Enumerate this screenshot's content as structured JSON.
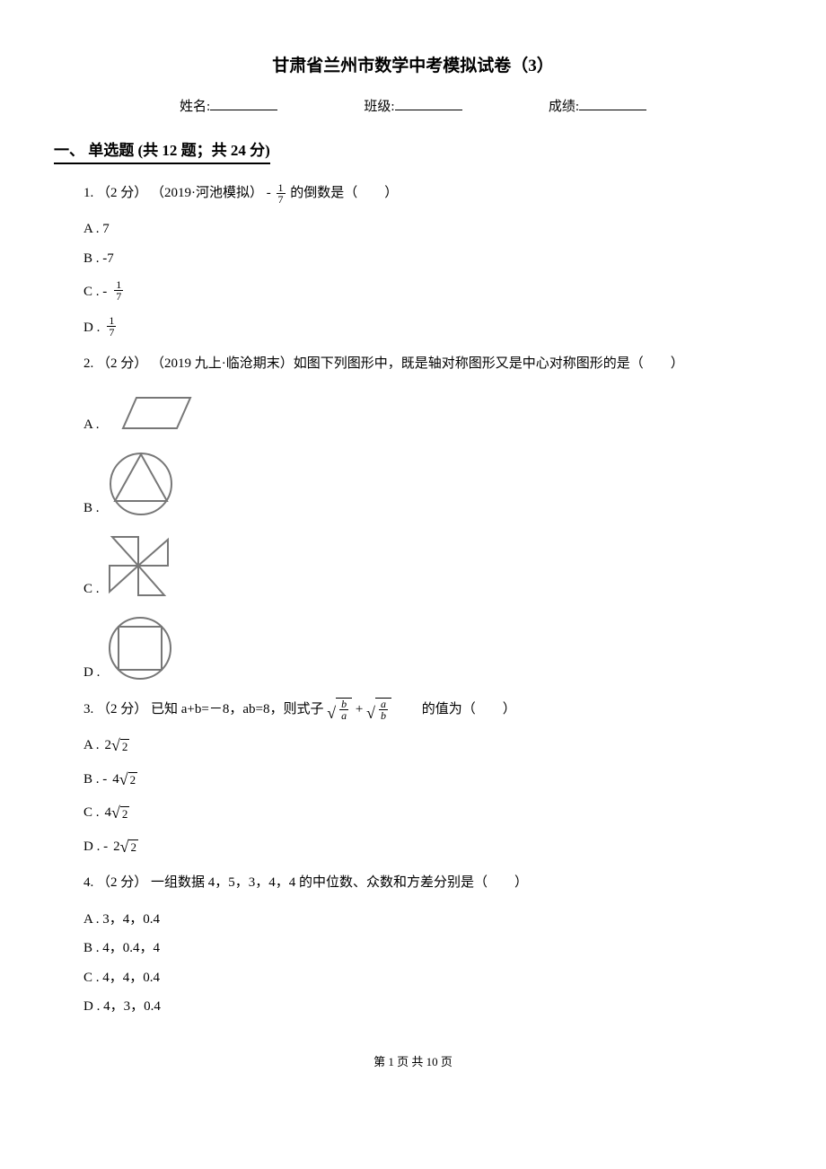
{
  "title": "甘肃省兰州市数学中考模拟试卷（3）",
  "meta": {
    "name_label": "姓名:",
    "class_label": "班级:",
    "score_label": "成绩:"
  },
  "section1": {
    "header": "一、 单选题 (共 12 题；共 24 分)"
  },
  "q1": {
    "stem_a": "1.  （2 分） （2019·河池模拟） - ",
    "frac_n": "1",
    "frac_d": "7",
    "stem_b": " 的倒数是（　　）",
    "A": "A .  7",
    "B": "B .  -7",
    "C": "C .  - ",
    "C_frac_n": "1",
    "C_frac_d": "7",
    "D": "D .  ",
    "D_frac_n": "1",
    "D_frac_d": "7"
  },
  "q2": {
    "stem": "2.  （2 分） （2019 九上·临沧期末）如图下列图形中，既是轴对称图形又是中心对称图形的是（　　）",
    "A": "A . ",
    "B": "B . ",
    "C": "C . ",
    "D": "D . "
  },
  "q3": {
    "stem_a": "3.  （2 分）  已知 a+b=－8，ab=8，则式子",
    "root1_n": "b",
    "root1_d": "a",
    "plus": " +",
    "root2_n": "a",
    "root2_d": "b",
    "stem_b": "　　的值为（　　）",
    "A_pre": "A .  ",
    "A_coef": "2",
    "A_rad": "2",
    "B_pre": "B .  -",
    "B_coef": "4",
    "B_rad": "2",
    "C_pre": "C .  ",
    "C_coef": "4",
    "C_rad": "2",
    "D_pre": "D .  -",
    "D_coef": "2",
    "D_rad": "2"
  },
  "q4": {
    "stem": "4.  （2 分）  一组数据 4，5，3，4，4 的中位数、众数和方差分别是（　　）",
    "A": "A .  3，4，0.4",
    "B": "B .  4，0.4，4",
    "C": "C .  4，4，0.4",
    "D": "D .  4，3，0.4"
  },
  "footer": "第 1 页 共 10 页"
}
